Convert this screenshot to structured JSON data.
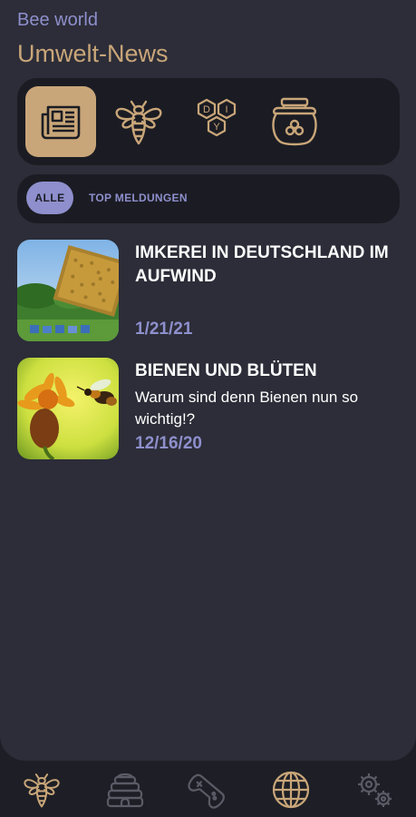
{
  "header": {
    "app_name": "Bee world",
    "title": "Umwelt-News"
  },
  "categories": [
    {
      "icon": "newspaper-icon",
      "active": true
    },
    {
      "icon": "bee-icon",
      "active": false
    },
    {
      "icon": "diy-hexagon-icon",
      "active": false,
      "letters": [
        "D",
        "I",
        "Y"
      ]
    },
    {
      "icon": "honey-jar-icon",
      "active": false
    }
  ],
  "filters": {
    "selected": "ALLE",
    "other": "TOP MELDUNGEN"
  },
  "news": [
    {
      "title": "IMKEREI IN DEUTSCHLAND IM AUFWIND",
      "subtitle": "",
      "date": "1/21/21"
    },
    {
      "title": "BIENEN UND BLÜTEN",
      "subtitle": "Warum sind denn Bienen nun so wichtig!?",
      "date": "12/16/20"
    }
  ],
  "bottom_nav": [
    {
      "icon": "bee-icon"
    },
    {
      "icon": "beehive-icon"
    },
    {
      "icon": "gamepad-icon"
    },
    {
      "icon": "globe-icon",
      "active": true
    },
    {
      "icon": "settings-gears-icon"
    }
  ],
  "colors": {
    "background": "#2c2d38",
    "bar": "#1b1c23",
    "gold": "#c9a679",
    "lavender": "#8e8fcc",
    "text": "#ffffff"
  }
}
